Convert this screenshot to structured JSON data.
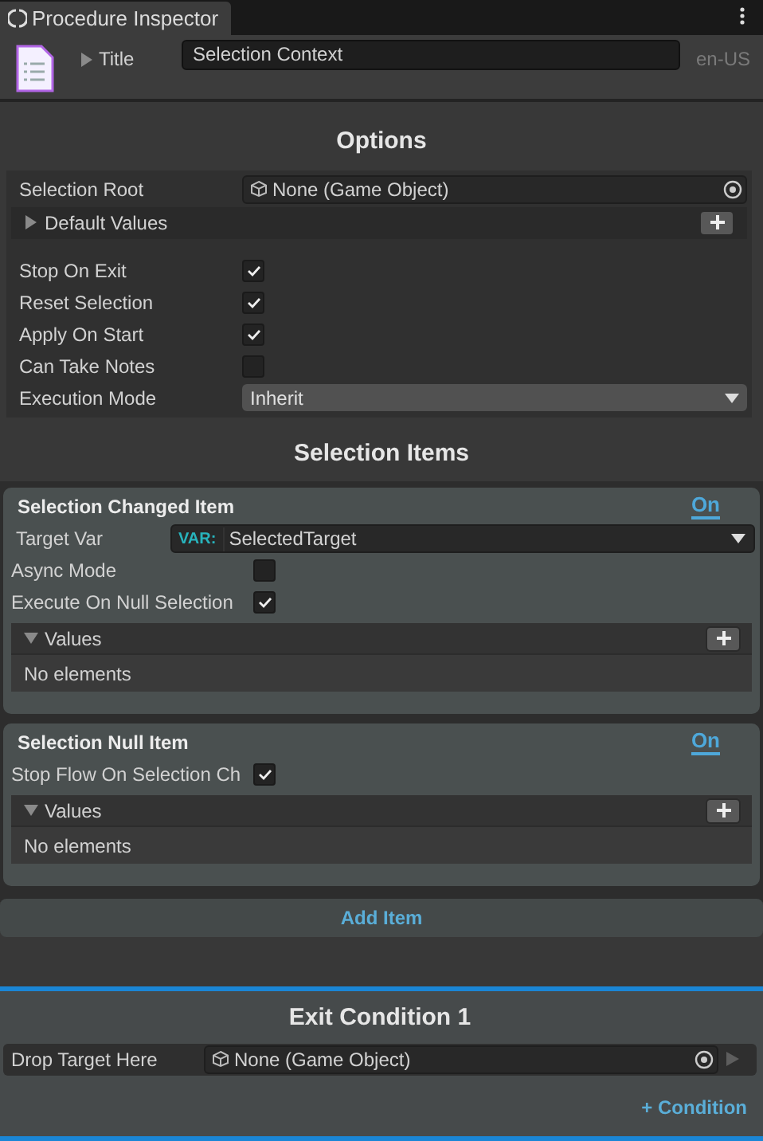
{
  "tab": {
    "title": "Procedure Inspector"
  },
  "header": {
    "title_label": "Title",
    "title_value": "Selection Context",
    "locale": "en-US"
  },
  "options": {
    "heading": "Options",
    "rows": [
      {
        "kind": "object",
        "label": "Selection Root",
        "value": "None (Game Object)"
      },
      {
        "kind": "foldout",
        "label": "Default Values",
        "expanded": false
      },
      {
        "kind": "spacer"
      },
      {
        "kind": "checkbox",
        "label": "Stop On Exit",
        "checked": true
      },
      {
        "kind": "checkbox",
        "label": "Reset Selection",
        "checked": true
      },
      {
        "kind": "checkbox",
        "label": "Apply On Start",
        "checked": true
      },
      {
        "kind": "checkbox",
        "label": "Can Take Notes",
        "checked": false
      },
      {
        "kind": "dropdown",
        "label": "Execution Mode",
        "value": "Inherit"
      }
    ]
  },
  "selection_items": {
    "heading": "Selection Items",
    "items": [
      {
        "title": "Selection Changed Item",
        "toggle": "On",
        "fields": [
          {
            "kind": "variable",
            "label": "Target Var",
            "tag": "VAR:",
            "value": "SelectedTarget"
          },
          {
            "kind": "checkbox",
            "label": "Async Mode",
            "checked": false
          },
          {
            "kind": "checkbox",
            "label": "Execute On Null Selection",
            "checked": true
          }
        ],
        "list": {
          "label": "Values",
          "expanded": true,
          "empty_text": "No elements"
        }
      },
      {
        "title": "Selection Null Item",
        "toggle": "On",
        "fields": [
          {
            "kind": "checkbox",
            "label": "Stop Flow On Selection Ch",
            "checked": true
          }
        ],
        "list": {
          "label": "Values",
          "expanded": true,
          "empty_text": "No elements"
        }
      }
    ],
    "add_button": "Add Item"
  },
  "exit_condition": {
    "title": "Exit Condition 1",
    "field": {
      "label": "Drop Target Here",
      "value": "None (Game Object)"
    },
    "add_button": "+ Condition"
  }
}
